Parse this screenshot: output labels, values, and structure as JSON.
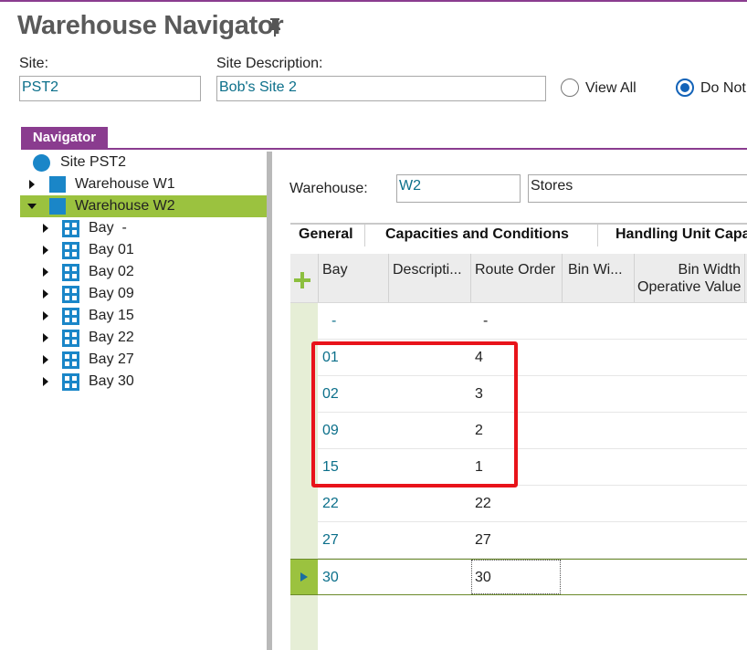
{
  "window": {
    "title": "Warehouse Navigator"
  },
  "form": {
    "site_label": "Site:",
    "site_value": "PST2",
    "site_desc_label": "Site Description:",
    "site_desc_value": "Bob's Site 2",
    "radio_view_all": "View All",
    "radio_do_not": "Do Not"
  },
  "navigator": {
    "tab_label": "Navigator",
    "tree": [
      {
        "label": "Site PST2"
      },
      {
        "label": "Warehouse W1"
      },
      {
        "label": "Warehouse W2"
      },
      {
        "label": "Bay  -"
      },
      {
        "label": "Bay 01"
      },
      {
        "label": "Bay 02"
      },
      {
        "label": "Bay 09"
      },
      {
        "label": "Bay 15"
      },
      {
        "label": "Bay 22"
      },
      {
        "label": "Bay 27"
      },
      {
        "label": "Bay 30"
      }
    ]
  },
  "detail": {
    "warehouse_label": "Warehouse:",
    "warehouse_id": "W2",
    "warehouse_desc": "Stores",
    "tabs": [
      "General",
      "Capacities and Conditions",
      "Handling Unit Capa"
    ],
    "columns": [
      "Bay",
      "Descripti...",
      "Route Order",
      "Bin Wi...",
      "Bin Width",
      "Operative Value"
    ],
    "rows": [
      {
        "bay": "-",
        "route": "-"
      },
      {
        "bay": "01",
        "route": "4"
      },
      {
        "bay": "02",
        "route": "3"
      },
      {
        "bay": "09",
        "route": "2"
      },
      {
        "bay": "15",
        "route": "1"
      },
      {
        "bay": "22",
        "route": "22"
      },
      {
        "bay": "27",
        "route": "27"
      },
      {
        "bay": "30",
        "route": "30"
      }
    ]
  },
  "colors": {
    "accent_purple": "#8a3c8f",
    "selection_green": "#9bc23f",
    "icon_blue": "#1a86c8",
    "link_teal": "#0b6f8a",
    "highlight_red": "#e8131a"
  }
}
